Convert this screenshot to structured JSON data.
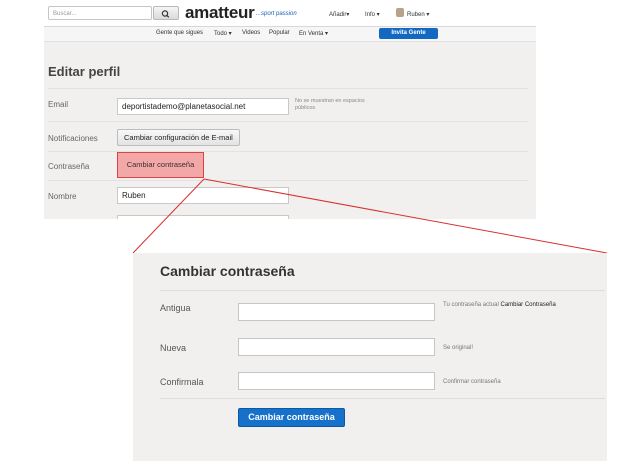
{
  "header": {
    "search_placeholder": "Buscar...",
    "logo": "amatteur",
    "tagline": "...sport passion",
    "menu_add": "Añadir▾",
    "menu_info": "Info ▾",
    "menu_user": "Ruben ▾"
  },
  "subnav": {
    "items": [
      "Gente que sigues",
      "Todo ▾",
      "Videos",
      "Popular",
      "En Venta ▾"
    ],
    "invite": "Invita Gente"
  },
  "profile": {
    "title": "Editar perfil",
    "email_label": "Email",
    "email_value": "deportistademo@planetasocial.net",
    "email_hint": "No se muestran en espacios públicos",
    "notifications_label": "Notificaciones",
    "notifications_button": "Cambiar configuración de E-mail",
    "password_label": "Contraseña",
    "password_button": "Cambiar contraseña",
    "name_label": "Nombre",
    "name_value": "Ruben"
  },
  "change_password": {
    "title": "Cambiar contraseña",
    "old_label": "Antigua",
    "old_hint_prefix": "Tu contraseña actual",
    "old_hint_link": "Cambiar Contraseña",
    "new_label": "Nueva",
    "new_hint": "Se original!",
    "confirm_label": "Confirmala",
    "confirm_hint": "Confirmar contraseña",
    "submit": "Cambiar contraseña"
  },
  "colors": {
    "accent_blue": "#1571c9",
    "highlight_red": "#d94545",
    "highlight_fill": "#f3a7a7"
  }
}
